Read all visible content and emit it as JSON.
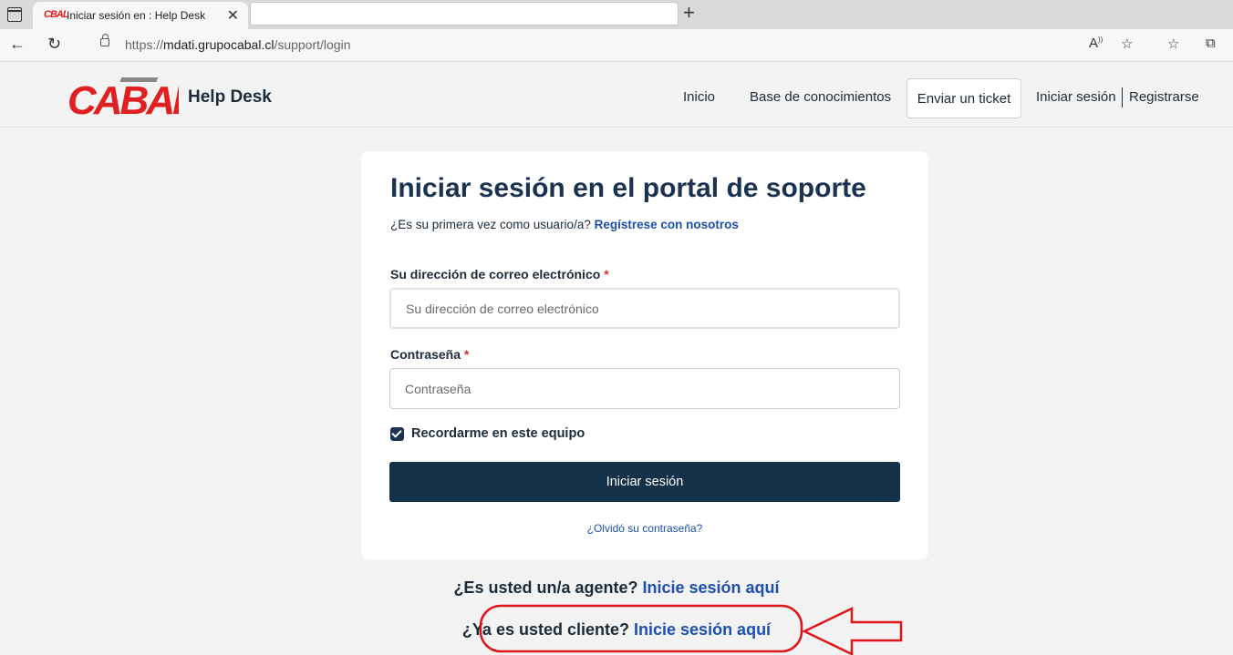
{
  "browser": {
    "tab_favicon_text": "CBAL",
    "tab_title": "Iniciar sesión en : Help Desk",
    "tab_close": "✕",
    "new_tab": "+",
    "back": "←",
    "reload": "↻",
    "url_prefix": "https://",
    "url_host": "mdati.grupocabal.cl",
    "url_path": "/support/login",
    "icons": [
      "read-aloud-icon",
      "favorites-add-icon",
      "favorites-icon",
      "collections-icon"
    ]
  },
  "header": {
    "logo_text": "CABAL",
    "brand": "Help Desk",
    "nav": {
      "home": "Inicio",
      "kb": "Base de conocimientos",
      "ticket": "Enviar un ticket",
      "login": "Iniciar sesión",
      "register": "Registrarse"
    }
  },
  "login": {
    "title": "Iniciar sesión en el portal de soporte",
    "first_time": "¿Es su primera vez como usuario/a?",
    "register_link": "Regístrese con nosotros",
    "email_label": "Su dirección de correo electrónico",
    "email_placeholder": "Su dirección de correo electrónico",
    "password_label": "Contraseña",
    "password_placeholder": "Contraseña",
    "required_mark": "*",
    "remember_label": "Recordarme en este equipo",
    "remember_checked": true,
    "submit_label": "Iniciar sesión",
    "forgot_link": "¿Olvidó su contraseña?"
  },
  "footer": {
    "agent_question": "¿Es usted un/a agente?",
    "agent_link": "Inicie sesión aquí",
    "client_question": "¿Ya es usted cliente?",
    "client_link": "Inicie sesión aquí"
  },
  "colors": {
    "brand_red": "#e02020",
    "navy": "#14314a",
    "link_blue": "#1d4fb0",
    "annotation_red": "#e0151a"
  }
}
